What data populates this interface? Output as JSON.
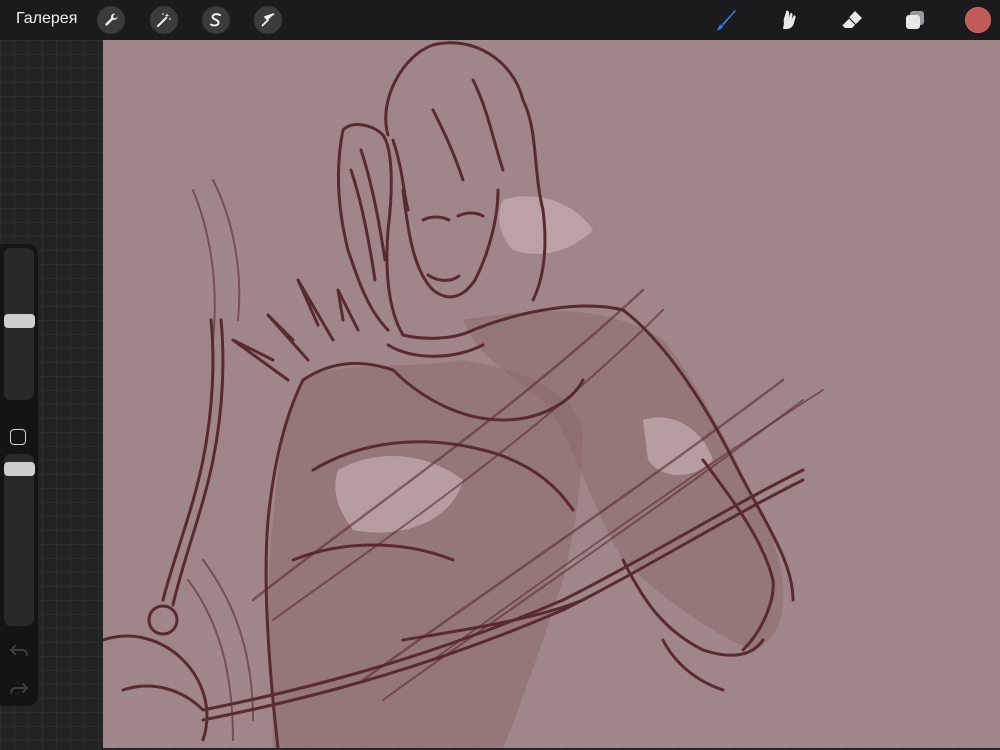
{
  "toolbar": {
    "gallery_label": "Галерея",
    "left_tools": [
      {
        "name": "actions",
        "icon": "wrench-icon"
      },
      {
        "name": "adjustments",
        "icon": "magic-wand-icon"
      },
      {
        "name": "selection",
        "icon": "selection-s-icon"
      },
      {
        "name": "transform",
        "icon": "arrow-cursor-icon"
      }
    ],
    "right_tools": [
      {
        "name": "brush",
        "icon": "brush-icon",
        "active": true
      },
      {
        "name": "smudge",
        "icon": "smudge-finger-icon",
        "active": false
      },
      {
        "name": "eraser",
        "icon": "eraser-icon",
        "active": false
      },
      {
        "name": "layers",
        "icon": "layers-icon",
        "active": false
      }
    ],
    "current_color": "#c15a58",
    "active_tool_color": "#2f7df6"
  },
  "sidebar": {
    "brush_size_level": 0.52,
    "opacity_level": 0.95,
    "modifier_icon": "square-modifier-icon",
    "undo_icon": "undo-icon",
    "redo_icon": "redo-icon"
  },
  "canvas": {
    "background_color": "#a08688",
    "line_color": "#5a2a31",
    "shade_color": "#8d6a6e",
    "highlight_color": "#c8aeb0"
  }
}
